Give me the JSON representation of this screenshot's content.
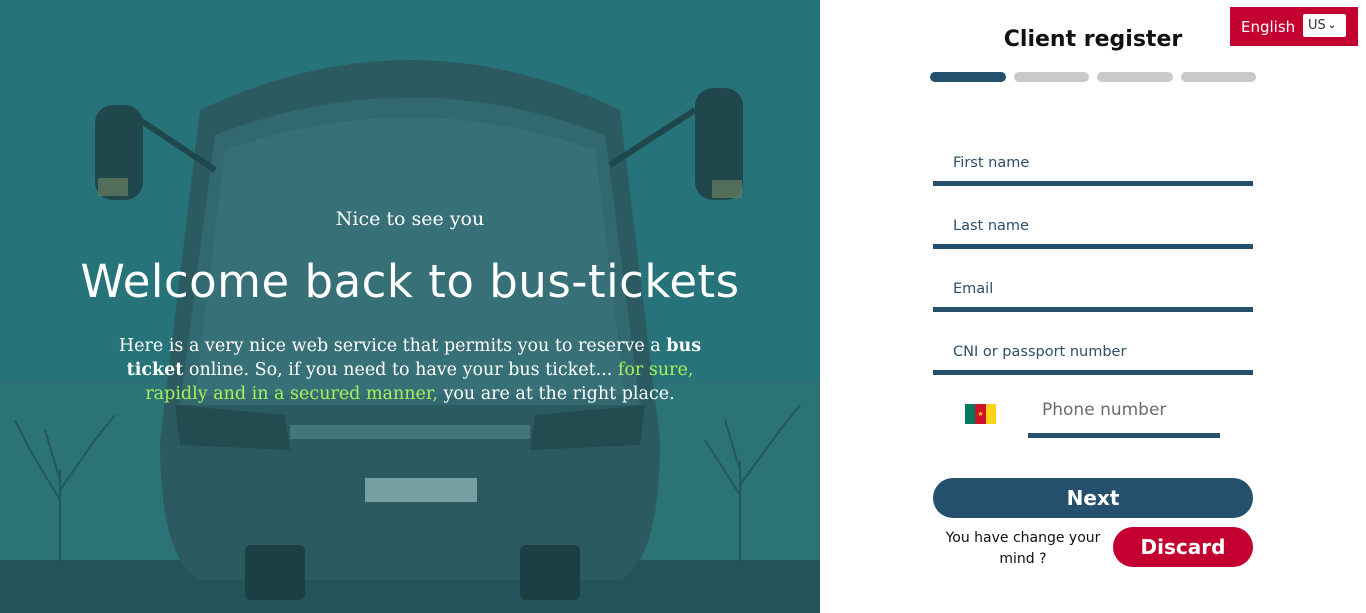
{
  "hero": {
    "subtitle": "Nice to see you",
    "title": "Welcome back to bus-tickets",
    "text_part1": "Here is a very nice web service that permits you to reserve a ",
    "text_bold": "bus ticket",
    "text_part2": " online. So, if you need to have your bus ticket... ",
    "text_highlight": "for sure, rapidly and in a secured manner,",
    "text_part3": " you are at the right place."
  },
  "language": {
    "label": "English",
    "selected": "US"
  },
  "form": {
    "title": "Client register",
    "steps_total": 4,
    "current_step": 1,
    "fields": {
      "first_name_placeholder": "First name",
      "last_name_placeholder": "Last name",
      "email_placeholder": "Email",
      "id_placeholder": "CNI or passport number",
      "phone_placeholder": "Phone number"
    },
    "next_label": "Next",
    "change_mind_text": "You have change your mind ?",
    "discard_label": "Discard"
  },
  "colors": {
    "primary": "#24506e",
    "accent_red": "#c3002f",
    "highlight_green": "#a7f05a",
    "step_inactive": "#c9c9c9"
  }
}
